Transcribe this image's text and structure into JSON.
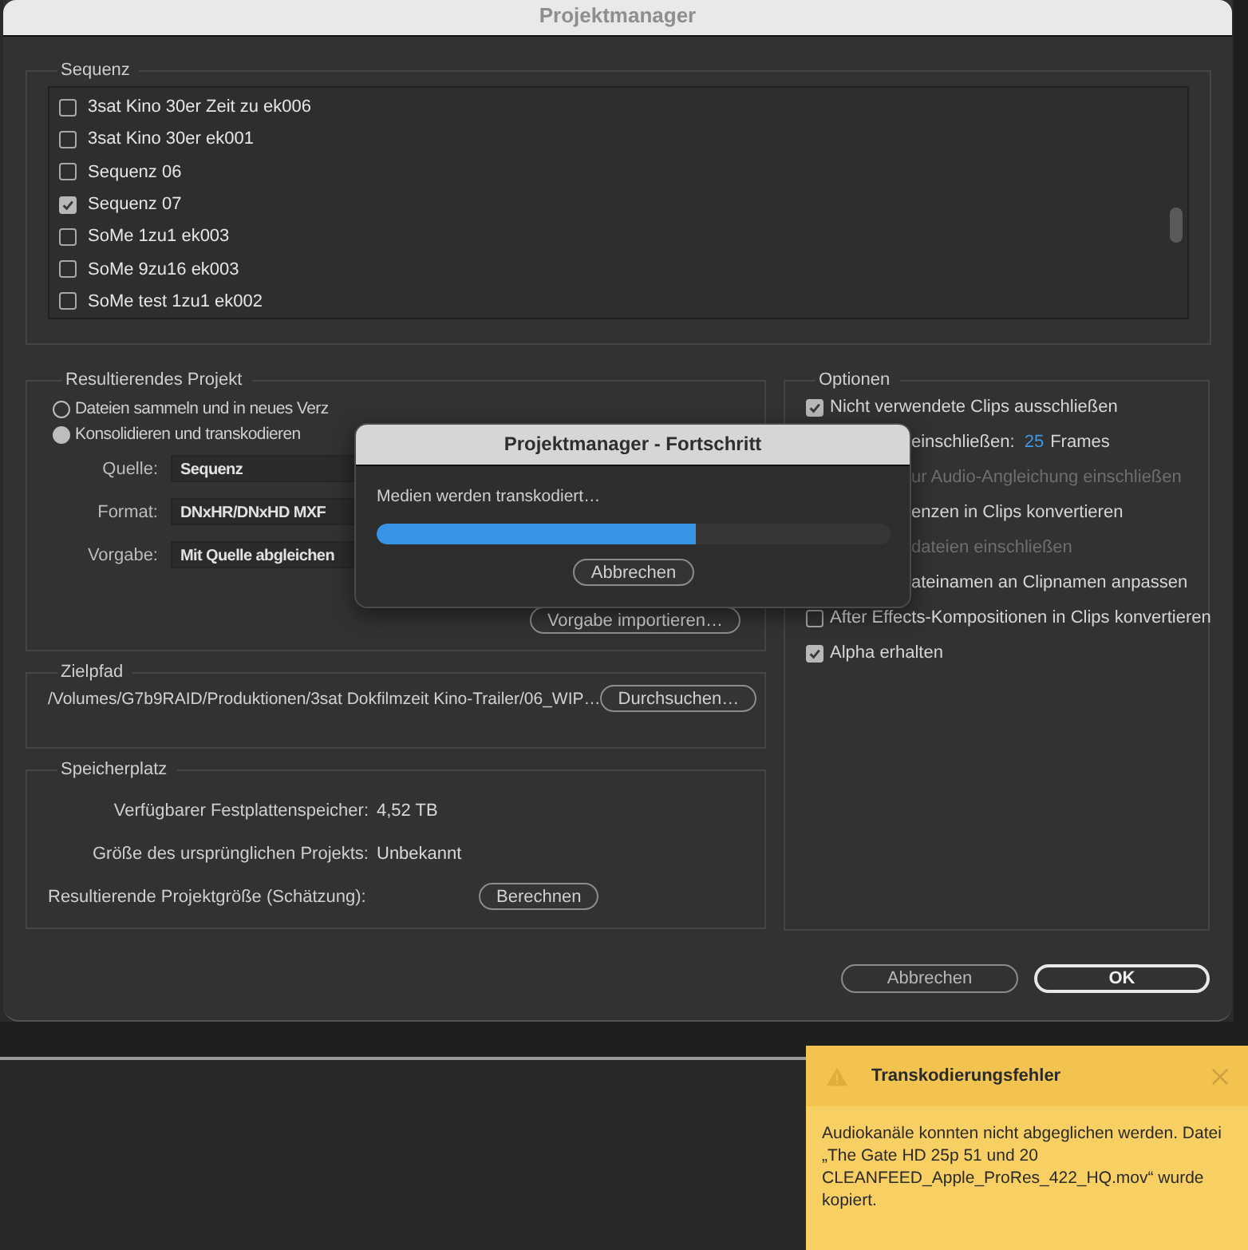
{
  "window": {
    "title": "Projektmanager"
  },
  "sequence": {
    "label": "Sequenz",
    "items": [
      {
        "name": "3sat Kino 30er Zeit zu ek006",
        "checked": false
      },
      {
        "name": "3sat Kino 30er ek001",
        "checked": false
      },
      {
        "name": "Sequenz 06",
        "checked": false
      },
      {
        "name": "Sequenz 07",
        "checked": true
      },
      {
        "name": "SoMe 1zu1 ek003",
        "checked": false
      },
      {
        "name": "SoMe 9zu16 ek003",
        "checked": false
      },
      {
        "name": "SoMe test 1zu1 ek002",
        "checked": false
      }
    ]
  },
  "resulting_project": {
    "label": "Resultierendes Projekt",
    "modes": [
      {
        "label": "Dateien sammeln und in neues Verz",
        "selected": false
      },
      {
        "label": "Konsolidieren und transkodieren",
        "selected": true
      }
    ],
    "fields": [
      {
        "label": "Quelle:",
        "value": "Sequenz"
      },
      {
        "label": "Format:",
        "value": "DNxHR/DNxHD MXF"
      },
      {
        "label": "Vorgabe:",
        "value": "Mit Quelle abgleichen"
      }
    ],
    "import_button": "Vorgabe importieren…"
  },
  "target_path": {
    "label": "Zielpfad",
    "path": "/Volumes/G7b9RAID/Produktionen/3sat Dokfilmzeit Kino-Trailer/06_WIP…",
    "browse_button": "Durchsuchen…"
  },
  "storage": {
    "label": "Speicherplatz",
    "rows": [
      {
        "kind": "value",
        "label": "Verfügbarer Festplattenspeicher:",
        "value": "4,52 TB"
      },
      {
        "kind": "value",
        "label": "Größe des ursprünglichen Projekts:",
        "value": "Unbekannt"
      },
      {
        "kind": "action",
        "label": "Resultierende Projektgröße (Schätzung):",
        "button": "Berechnen"
      }
    ]
  },
  "options": {
    "label": "Optionen",
    "items": [
      {
        "kind": "checkbox",
        "label": "Nicht verwendete Clips ausschließen",
        "checked": true,
        "disabled": false
      },
      {
        "kind": "partial",
        "label": "einschließen:",
        "value": "25",
        "unit": "Frames",
        "disabled": false
      },
      {
        "kind": "partial",
        "label": "ur Audio-Angleichung einschließen",
        "disabled": true
      },
      {
        "kind": "partial",
        "label": "enzen in Clips konvertieren",
        "disabled": false
      },
      {
        "kind": "partial",
        "label": "dateien einschließen",
        "disabled": true
      },
      {
        "kind": "partial",
        "label": "ateinamen an Clipnamen anpassen",
        "disabled": false
      },
      {
        "kind": "checkbox",
        "label": "After Effects-Kompositionen in Clips konvertieren",
        "checked": false,
        "disabled": false
      },
      {
        "kind": "checkbox",
        "label": "Alpha erhalten",
        "checked": true,
        "disabled": false
      }
    ]
  },
  "buttons": [
    {
      "label": "Abbrechen",
      "default": false
    },
    {
      "label": "OK",
      "default": true
    }
  ],
  "progress": {
    "title": "Projektmanager - Fortschritt",
    "message": "Medien werden transkodiert…",
    "level": 0.62,
    "button": "Abbrechen"
  },
  "toast": {
    "title": "Transkodierungsfehler",
    "message": "Audiokanäle konnten nicht abgeglichen werden. Datei „The Gate HD 25p 51 und 20 CLEANFEED_Apple_ProRes_422_HQ.mov“ wurde kopiert."
  }
}
